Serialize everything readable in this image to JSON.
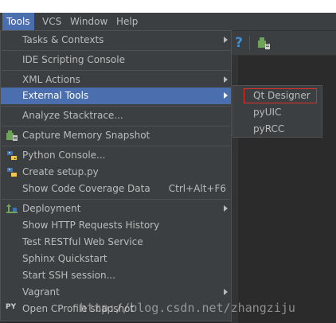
{
  "menubar": {
    "items": [
      {
        "label": "Tools",
        "active": true
      },
      {
        "label": "VCS",
        "active": false
      },
      {
        "label": "Window",
        "active": false
      },
      {
        "label": "Help",
        "active": false
      }
    ]
  },
  "toolbar": {
    "help_glyph": "?"
  },
  "tools_menu": {
    "items": [
      {
        "label": "Tasks & Contexts",
        "submenu": true
      },
      {
        "label": "IDE Scripting Console"
      },
      {
        "label": "XML Actions",
        "submenu": true
      },
      {
        "label": "External Tools",
        "submenu": true,
        "selected": true
      },
      {
        "label": "Analyze Stacktrace..."
      },
      {
        "label": "Capture Memory Snapshot",
        "icon": "memory-snapshot-icon"
      },
      {
        "label": "Python Console...",
        "icon": "python-icon"
      },
      {
        "label": "Create setup.py",
        "icon": "python-setup-icon"
      },
      {
        "label": "Show Code Coverage Data",
        "shortcut": "Ctrl+Alt+F6"
      },
      {
        "label": "Deployment",
        "submenu": true,
        "icon": "deployment-icon"
      },
      {
        "label": "Show HTTP Requests History"
      },
      {
        "label": "Test RESTful Web Service"
      },
      {
        "label": "Sphinx Quickstart"
      },
      {
        "label": "Start SSH session..."
      },
      {
        "label": "Vagrant",
        "submenu": true
      },
      {
        "label": "Open CProfile snapshot",
        "icon": "cprofile-icon",
        "icon_text": "PY"
      }
    ]
  },
  "external_tools_submenu": {
    "items": [
      {
        "label": "Qt Designer",
        "highlighted": true
      },
      {
        "label": "pyUIC"
      },
      {
        "label": "pyRCC"
      }
    ],
    "highlight_color": "#e0302c"
  },
  "watermark": "http://blog.csdn.net/zhangziju",
  "colors": {
    "menu_bg": "#3c3f41",
    "selection": "#4b6eaf",
    "text": "#bbbbbb",
    "editor_bg": "#2b2b2b"
  }
}
